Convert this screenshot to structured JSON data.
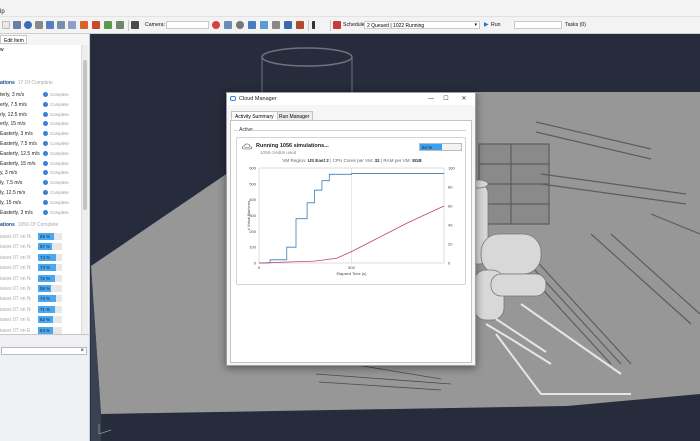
{
  "menubar": {
    "help_label": "lp"
  },
  "toolbar": {
    "camera_label": "Camera:",
    "schedule_label": "Schedule:",
    "schedule_value": "2 Queued | 1022 Running",
    "run_label": "Run",
    "tasks_label": "Tasks (0)"
  },
  "left_panel": {
    "edit_tab": "Edit Item",
    "header_w": "w",
    "section1_title": "ations",
    "section1_count": "17 Of Complete",
    "rows1": [
      {
        "label": "terly, 3 m/s",
        "status": "Complete"
      },
      {
        "label": "erly, 7.5 m/s",
        "status": "Complete"
      },
      {
        "label": "rly, 12.5 m/s",
        "status": "Complete"
      },
      {
        "label": "erly, 15 m/s",
        "status": "Complete"
      },
      {
        "label": "Easterly, 3 m/s",
        "status": "Complete"
      },
      {
        "label": "Easterly, 7.5 m/s",
        "status": "Complete"
      },
      {
        "label": "Easterly, 12.5 m/s",
        "status": "Complete"
      },
      {
        "label": "Easterly, 15 m/s",
        "status": "Complete"
      },
      {
        "label": "y, 3 m/s",
        "status": "Complete"
      },
      {
        "label": "ly, 7.5 m/s",
        "status": "Complete"
      },
      {
        "label": "ly, 12.5 m/s",
        "status": "Complete"
      },
      {
        "label": "ly, 15 m/s",
        "status": "Complete"
      },
      {
        "label": "Easterly, 3 m/s",
        "status": "Complete"
      }
    ],
    "section2_title": "ations",
    "section2_count": "1056 Of Complete",
    "rows2": [
      {
        "label": "iases 07 on N",
        "pct": 65
      },
      {
        "label": "iases 07 on N",
        "pct": 57
      },
      {
        "label": "iases 07 on N",
        "pct": 74
      },
      {
        "label": "iases 07 on N",
        "pct": 73
      },
      {
        "label": "iases 07 on N",
        "pct": 72
      },
      {
        "label": "iases 07 on N",
        "pct": 55
      },
      {
        "label": "iases 07 on N",
        "pct": 74
      },
      {
        "label": "iases 07 on N",
        "pct": 71
      },
      {
        "label": "iases 07 on E",
        "pct": 62
      },
      {
        "label": "iases 07 on E",
        "pct": 64
      }
    ],
    "search_clear": "×"
  },
  "dialog": {
    "title": "Cloud Manager",
    "minimize": "—",
    "maximize": "☐",
    "close": "✕",
    "tabs": [
      "Activity Summary",
      "Run Manager"
    ],
    "active_label": "Active",
    "card": {
      "heading": "Running 1056 simulations...",
      "subheading": "1056 credits used",
      "progress_pct": 54,
      "progress_text": "54 %",
      "info_prefix_1": "VM Region: ",
      "region": "US East 2",
      "info_prefix_2": " | CPU Cores per VM: ",
      "cores": "32",
      "info_prefix_3": " | RAM per VM: ",
      "ram": "8GB"
    }
  },
  "colors": {
    "accent": "#3aa0f0",
    "vm_line": "#3a7fb8",
    "progress_line": "#c0407a",
    "viewport_bg": "#262c3c"
  },
  "chart_data": {
    "type": "line",
    "xlabel": "Elapsed Time (s)",
    "ylabel": "# Virtual Machines",
    "x_ticks": [
      "0",
      "500"
    ],
    "y_ticks": [
      0,
      100,
      200,
      300,
      400,
      500,
      600
    ],
    "y2_ticks": [
      0,
      20,
      40,
      60,
      80,
      100
    ],
    "xlim": [
      0,
      1000
    ],
    "ylim": [
      0,
      600
    ],
    "y2lim": [
      0,
      100
    ],
    "series": [
      {
        "axis": "left",
        "color": "#3a7fb8",
        "x": [
          0,
          60,
          60,
          150,
          150,
          200,
          200,
          260,
          260,
          300,
          300,
          340,
          340,
          380,
          380,
          500,
          500,
          1000
        ],
        "y": [
          0,
          0,
          20,
          20,
          100,
          100,
          280,
          280,
          380,
          380,
          460,
          460,
          520,
          520,
          560,
          560,
          565,
          565
        ]
      },
      {
        "axis": "right",
        "color": "#c0407a",
        "x": [
          0,
          300,
          420,
          500,
          600,
          700,
          800,
          900,
          1000
        ],
        "y": [
          0,
          2,
          5,
          12,
          22,
          32,
          42,
          51,
          60
        ]
      }
    ]
  }
}
